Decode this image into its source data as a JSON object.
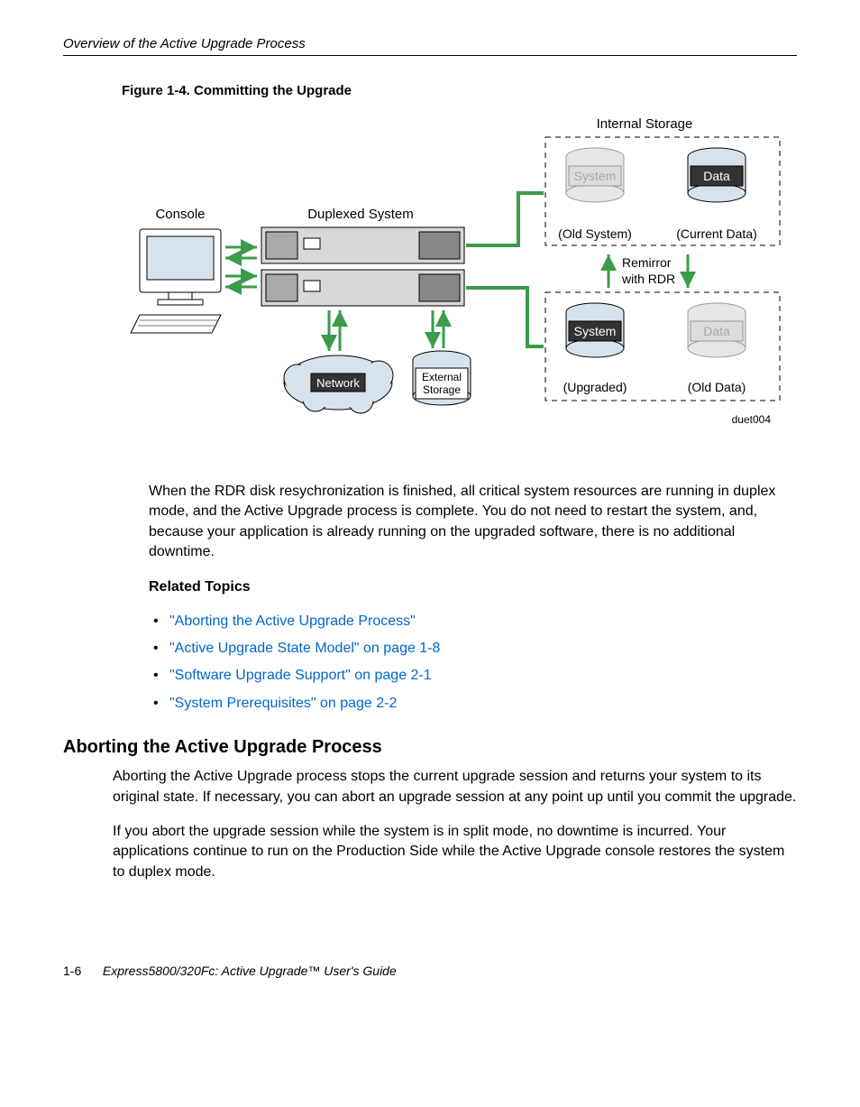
{
  "header": {
    "running": "Overview of the Active Upgrade Process"
  },
  "figure": {
    "caption": "Figure 1-4. Committing the Upgrade",
    "labels": {
      "internal_storage": "Internal Storage",
      "console": "Console",
      "duplexed_system": "Duplexed System",
      "system_old": "System",
      "data_current": "Data",
      "old_system": "(Old System)",
      "current_data": "(Current Data)",
      "remirror1": "Remirror",
      "remirror2": "with RDR",
      "network": "Network",
      "external1": "External",
      "external2": "Storage",
      "system_up": "System",
      "data_old": "Data",
      "upgraded": "(Upgraded)",
      "old_data": "(Old Data)",
      "ref": "duet004"
    }
  },
  "para1": "When the RDR disk resychronization is finished, all critical system resources are running in duplex mode, and the Active Upgrade process is complete. You do not need to restart the system, and, because your application is already running on the upgraded software, there is no additional downtime.",
  "related": {
    "heading": "Related Topics",
    "items": [
      "\"Aborting the Active Upgrade Process\"",
      "\"Active Upgrade State Model\" on page 1-8",
      "\"Software Upgrade Support\" on page 2-1",
      "\"System Prerequisites\" on page 2-2"
    ]
  },
  "section": {
    "title": "Aborting the Active Upgrade Process",
    "p1": "Aborting the Active Upgrade process stops the current upgrade session and returns your system to its original state. If necessary, you can abort an upgrade session at any point up until you commit the upgrade.",
    "p2": "If you abort the upgrade session while the system is in split mode, no downtime is incurred. Your applications continue to run on the Production Side while the Active Upgrade console restores the system to duplex mode."
  },
  "footer": {
    "page": "1-6",
    "title": "Express5800/320Fc: Active Upgrade™ User's Guide"
  }
}
